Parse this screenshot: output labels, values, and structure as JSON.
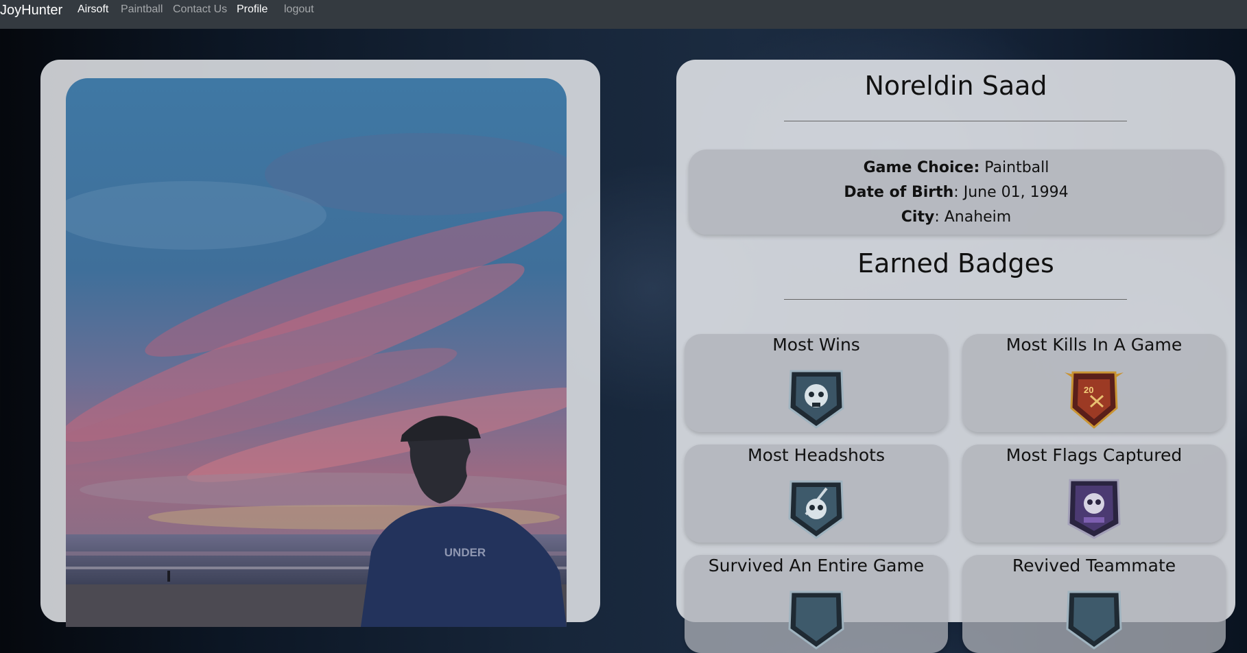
{
  "navbar": {
    "brand": "JoyHunter",
    "links": [
      {
        "label": "Airsoft",
        "active": true
      },
      {
        "label": "Paintball",
        "active": false
      },
      {
        "label": "Contact Us",
        "active": false
      },
      {
        "label": "Profile",
        "active": true
      },
      {
        "label": "logout",
        "active": false
      }
    ]
  },
  "profile": {
    "name": "Noreldin Saad",
    "game_choice_label": "Game Choice:",
    "game_choice": " Paintball",
    "dob_label": "Date of Birth",
    "dob": ": June 01, 1994",
    "city_label": "City",
    "city": ": Anaheim",
    "photo_shirt_text": "UNDER"
  },
  "badges": {
    "section_title": "Earned Badges",
    "items": [
      {
        "title": "Most Wins",
        "icon": "skull-badge-icon"
      },
      {
        "title": "Most Kills In A Game",
        "icon": "gold-20-badge-icon"
      },
      {
        "title": "Most Headshots",
        "icon": "skull-knife-badge-icon"
      },
      {
        "title": "Most Flags Captured",
        "icon": "purple-skull-badge-icon"
      },
      {
        "title": "Survived An Entire Game",
        "icon": "shield-badge-icon"
      },
      {
        "title": "Revived Teammate",
        "icon": "shield-badge-icon"
      }
    ]
  },
  "colors": {
    "navbar_bg": "#343a40",
    "card_bg": "#e4e6ea",
    "box_bg": "#afb2b8"
  }
}
